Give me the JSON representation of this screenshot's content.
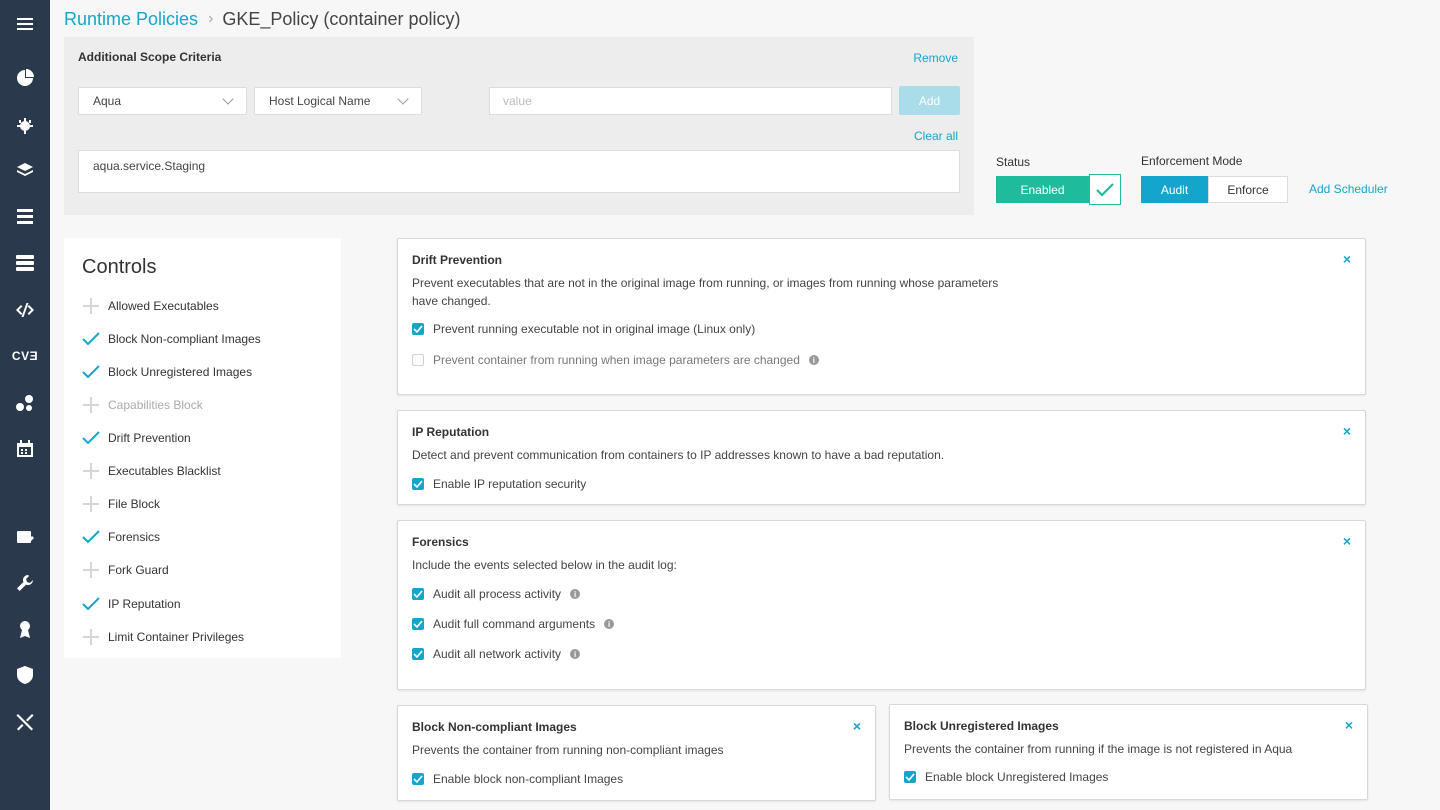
{
  "colors": {
    "accent": "#14a5cc",
    "enabled": "#1ebc9c",
    "sidebar": "#2a3a4c"
  },
  "sidebar": {
    "items": [
      {
        "icon": "menu-icon"
      },
      {
        "icon": "dashboard-icon"
      },
      {
        "icon": "bug-icon"
      },
      {
        "icon": "layers-icon"
      },
      {
        "icon": "workloads-icon"
      },
      {
        "icon": "servers-icon"
      },
      {
        "icon": "code-icon"
      },
      {
        "icon": "cve-icon",
        "text": "CVƎ"
      },
      {
        "icon": "network-icon"
      },
      {
        "icon": "calendar-icon"
      },
      {
        "icon": "policy-icon"
      },
      {
        "icon": "wrench-icon"
      },
      {
        "icon": "award-icon"
      },
      {
        "icon": "shield-icon"
      },
      {
        "icon": "tools-icon"
      }
    ]
  },
  "header": {
    "parent": "Runtime Policies",
    "current": "GKE_Policy (container policy)"
  },
  "scope": {
    "title": "Additional Scope Criteria",
    "remove": "Remove",
    "select1": "Aqua",
    "select2": "Host Logical Name",
    "value_placeholder": "value",
    "add": "Add",
    "clear_all": "Clear all",
    "expression": "aqua.service.Staging"
  },
  "status": {
    "label": "Status",
    "value": "Enabled",
    "enforcement_label": "Enforcement Mode",
    "audit": "Audit",
    "enforce": "Enforce",
    "add_scheduler": "Add Scheduler"
  },
  "controls": {
    "title": "Controls",
    "items": [
      {
        "label": "Allowed Executables",
        "state": "add"
      },
      {
        "label": "Block Non-compliant Images",
        "state": "checked"
      },
      {
        "label": "Block Unregistered Images",
        "state": "checked"
      },
      {
        "label": "Capabilities Block",
        "state": "disabled"
      },
      {
        "label": "Drift Prevention",
        "state": "checked"
      },
      {
        "label": "Executables Blacklist",
        "state": "add"
      },
      {
        "label": "File Block",
        "state": "add"
      },
      {
        "label": "Forensics",
        "state": "checked"
      },
      {
        "label": "Fork Guard",
        "state": "add"
      },
      {
        "label": "IP Reputation",
        "state": "checked"
      },
      {
        "label": "Limit Container Privileges",
        "state": "add"
      }
    ]
  },
  "cards": {
    "drift": {
      "title": "Drift Prevention",
      "desc1": "Prevent executables that are not in the original image from running, or images from running whose parameters",
      "desc2": "have changed.",
      "opt1": "Prevent running executable not in original image (Linux only)",
      "opt2": "Prevent container from running when image parameters are changed"
    },
    "ip": {
      "title": "IP Reputation",
      "desc": "Detect and prevent communication from containers to IP addresses known to have a bad reputation.",
      "opt1": "Enable IP reputation security"
    },
    "forensics": {
      "title": "Forensics",
      "desc": "Include the events selected below in the audit log:",
      "opt1": "Audit all process activity",
      "opt2": "Audit full command arguments",
      "opt3": "Audit all network activity"
    },
    "noncompliant": {
      "title": "Block Non-compliant Images",
      "desc": "Prevents the container from running non-compliant images",
      "opt1": "Enable block non-compliant Images"
    },
    "unregistered": {
      "title": "Block Unregistered Images",
      "desc": "Prevents the container from running if the image is not registered in Aqua",
      "opt1": "Enable block Unregistered Images"
    }
  },
  "close_glyph": "×",
  "info_glyph": "i"
}
